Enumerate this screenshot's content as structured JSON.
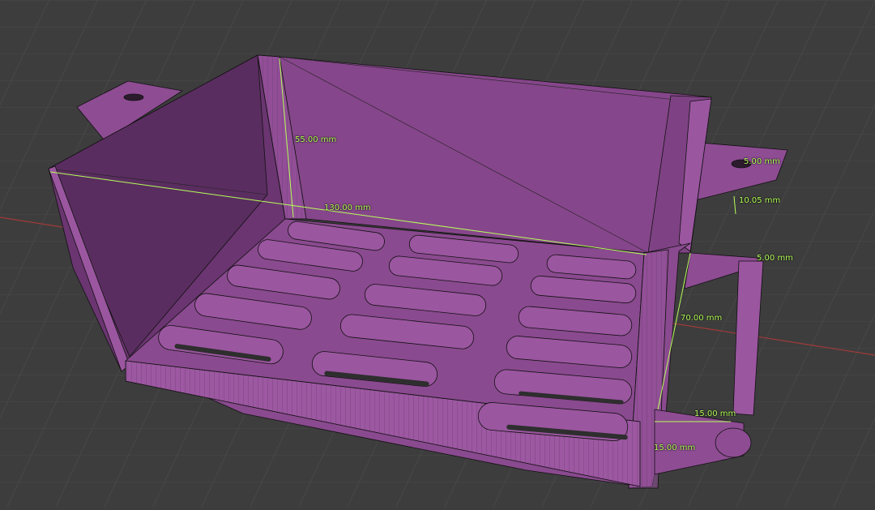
{
  "viewport": {
    "background": "#3d3d3d",
    "grid_color": "#4a4a4a",
    "x_axis_color": "#b03a3a",
    "mesh_color": "#8a4a8f",
    "edge_color": "#111111",
    "measure_color": "#b6ff5a"
  },
  "measurements": {
    "height": "55.00 mm",
    "length": "130.00 mm",
    "tab_width_upper": "5.00 mm",
    "tab_offset_upper": "10.05 mm",
    "handle_width": "5.00 mm",
    "handle_length": "70.00 mm",
    "handle_depth": "15.00 mm",
    "handle_height": "15.00 mm"
  }
}
